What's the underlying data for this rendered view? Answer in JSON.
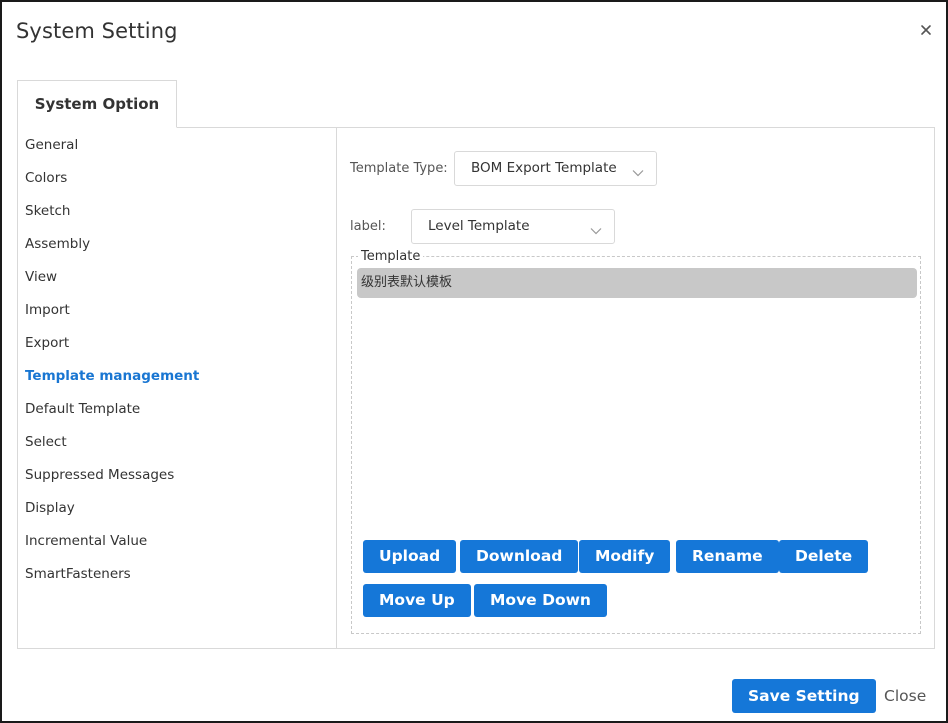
{
  "dialog": {
    "title": "System Setting",
    "close_icon": "close-icon"
  },
  "tabs": [
    {
      "label": "System Option",
      "active": true
    }
  ],
  "sidebar": {
    "items": [
      {
        "label": "General"
      },
      {
        "label": "Colors"
      },
      {
        "label": "Sketch"
      },
      {
        "label": "Assembly"
      },
      {
        "label": "View"
      },
      {
        "label": "Import"
      },
      {
        "label": "Export"
      },
      {
        "label": "Template management",
        "active": true
      },
      {
        "label": "Default Template"
      },
      {
        "label": "Select"
      },
      {
        "label": "Suppressed Messages"
      },
      {
        "label": "Display"
      },
      {
        "label": "Incremental Value"
      },
      {
        "label": "SmartFasteners"
      }
    ]
  },
  "content": {
    "template_type": {
      "label": "Template Type:",
      "value": "BOM Export Template",
      "icon": "chevron-down-icon"
    },
    "label_field": {
      "label": "label:",
      "value": "Level Template",
      "icon": "chevron-down-icon"
    },
    "template_group": {
      "legend": "Template",
      "items": [
        {
          "label": "级别表默认模板",
          "selected": true
        }
      ]
    },
    "buttons": {
      "upload": "Upload",
      "download": "Download",
      "modify": "Modify",
      "rename": "Rename",
      "delete": "Delete",
      "move_up": "Move Up",
      "move_down": "Move Down"
    }
  },
  "footer": {
    "save_label": "Save Setting",
    "close_label": "Close"
  },
  "colors": {
    "accent": "#1577d8",
    "active_nav": "#1976d2",
    "selected_row": "#c8c8c8",
    "border": "#d9d9d9"
  }
}
